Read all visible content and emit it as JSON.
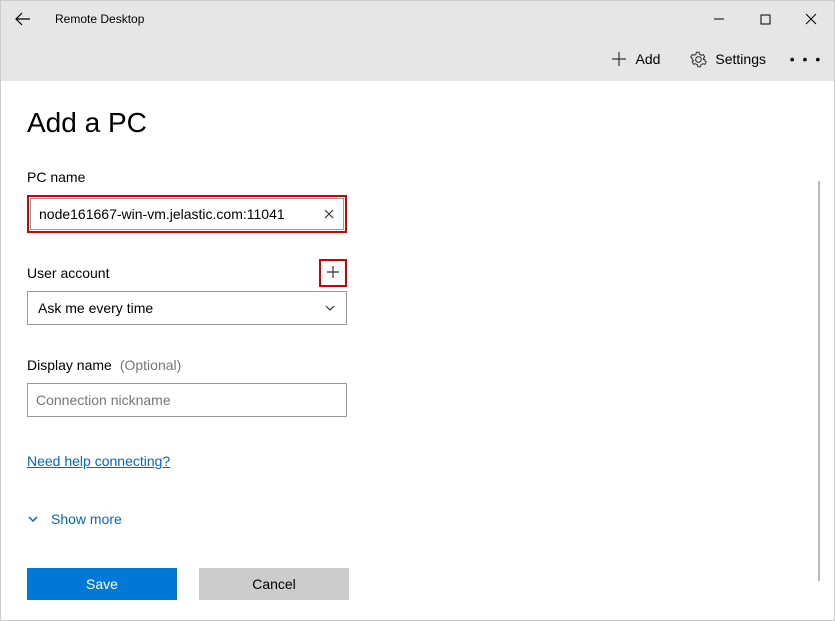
{
  "window": {
    "title": "Remote Desktop",
    "toolbar": {
      "add_label": "Add",
      "settings_label": "Settings"
    }
  },
  "page": {
    "title": "Add a PC",
    "pc_name": {
      "label": "PC name",
      "value": "node161667-win-vm.jelastic.com:11041"
    },
    "user_account": {
      "label": "User account",
      "selected": "Ask me every time"
    },
    "display_name": {
      "label": "Display name",
      "optional_hint": "(Optional)",
      "placeholder": "Connection nickname",
      "value": ""
    },
    "help_link": "Need help connecting?",
    "show_more": "Show more",
    "save_label": "Save",
    "cancel_label": "Cancel"
  }
}
